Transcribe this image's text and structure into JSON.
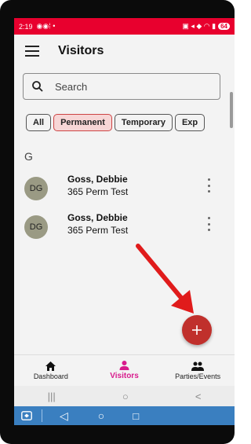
{
  "status_bar": {
    "time": "2:19",
    "battery": "64"
  },
  "app_bar": {
    "title": "Visitors"
  },
  "search": {
    "placeholder": "Search"
  },
  "filters": [
    {
      "label": "All",
      "selected": false
    },
    {
      "label": "Permanent",
      "selected": true
    },
    {
      "label": "Temporary",
      "selected": false
    },
    {
      "label": "Exp",
      "selected": false
    }
  ],
  "section_letter": "G",
  "visitors": [
    {
      "initials": "DG",
      "name": "Goss, Debbie",
      "subtitle": "365 Perm Test"
    },
    {
      "initials": "DG",
      "name": "Goss, Debbie",
      "subtitle": "365 Perm Test"
    }
  ],
  "fab": {
    "icon": "plus-icon",
    "color": "#c0302c"
  },
  "bottom_nav": {
    "items": [
      {
        "label": "Dashboard",
        "icon": "home-icon",
        "active": false
      },
      {
        "label": "Visitors",
        "icon": "person-icon",
        "active": true
      },
      {
        "label": "Parties/Events",
        "icon": "group-icon",
        "active": false
      }
    ]
  },
  "colors": {
    "status_bar": "#e8002e",
    "accent": "#d81b8c",
    "fab": "#c0302c",
    "annotation_arrow": "#e01b1b"
  }
}
